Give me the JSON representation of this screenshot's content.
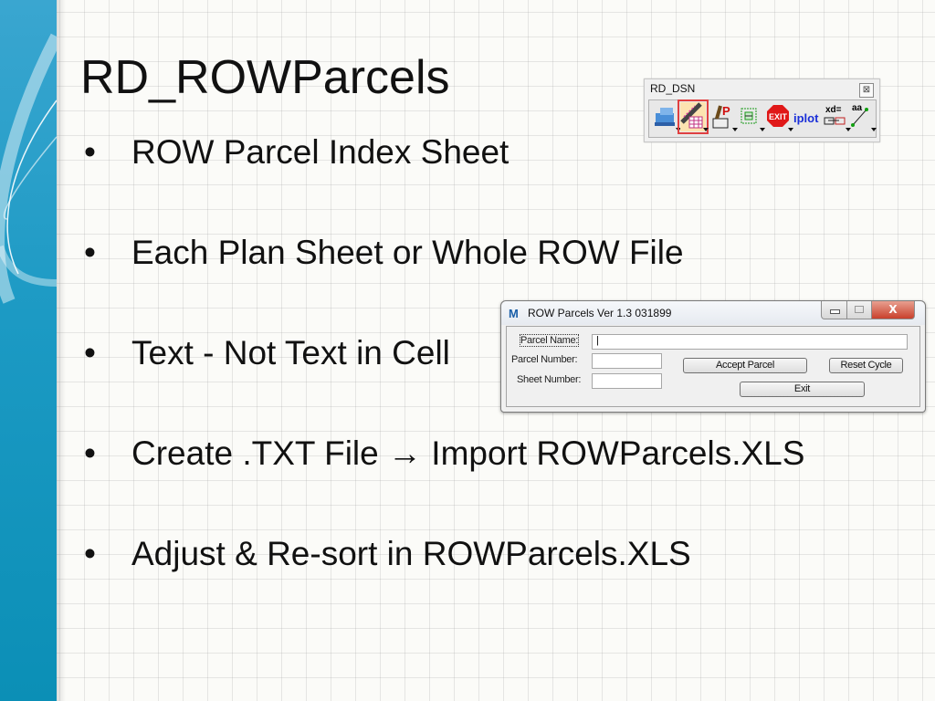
{
  "slide": {
    "title": "RD_ROWParcels",
    "bullets": [
      {
        "text": "ROW Parcel Index Sheet"
      },
      {
        "text": "Each Plan Sheet or Whole ROW File"
      },
      {
        "text": "Text - Not Text in Cell"
      },
      {
        "text": "Create .TXT File → Import ROWParcels.XLS"
      },
      {
        "text": "Adjust & Re-sort in ROWParcels.XLS"
      }
    ],
    "bullet_glyph": "•"
  },
  "toolbox": {
    "title": "RD_DSN",
    "close_glyph": "⊠",
    "tools": [
      {
        "name": "design-tool",
        "selected": false
      },
      {
        "name": "row-parcels-tool",
        "selected": true
      },
      {
        "name": "parcel-label-tool",
        "selected": false
      },
      {
        "name": "fence-tool",
        "selected": false
      },
      {
        "name": "exit-tool",
        "label": "EXIT",
        "selected": false
      },
      {
        "name": "iplot-tool",
        "label": "iplot",
        "selected": false
      },
      {
        "name": "xd-tool",
        "label": "xd=",
        "selected": false
      },
      {
        "name": "text-line-tool",
        "label": "aa",
        "selected": false
      }
    ],
    "accent": "#e04040"
  },
  "dialog": {
    "title": "ROW Parcels  Ver 1.3 031899",
    "app_icon": "M",
    "close_glyph": "X",
    "fields": {
      "parcel_name_label": "Parcel Name:",
      "parcel_name_value": "|",
      "parcel_number_label": "Parcel Number:",
      "parcel_number_value": "",
      "sheet_number_label": "Sheet Number:",
      "sheet_number_value": ""
    },
    "buttons": {
      "accept": "Accept Parcel",
      "reset": "Reset Cycle",
      "exit": "Exit"
    }
  }
}
